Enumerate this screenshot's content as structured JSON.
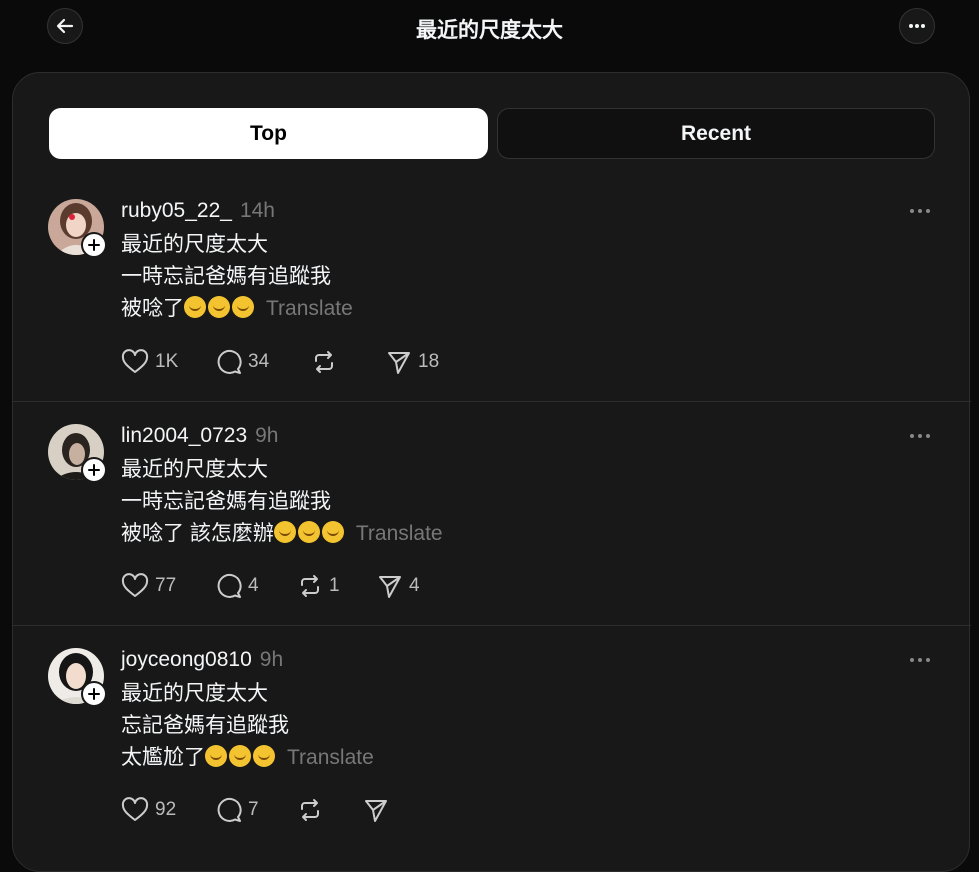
{
  "header": {
    "title": "最近的尺度太大"
  },
  "tabs": [
    {
      "label": "Top",
      "selected": true
    },
    {
      "label": "Recent",
      "selected": false
    }
  ],
  "translate_label": "Translate",
  "posts": [
    {
      "username": "ruby05_22_",
      "time": "14h",
      "lines": [
        "最近的尺度太大",
        "一時忘記爸媽有追蹤我",
        "被唸了"
      ],
      "likes": "1K",
      "replies": "34",
      "reposts": "",
      "shares": "18"
    },
    {
      "username": "lin2004_0723",
      "time": "9h",
      "lines": [
        "最近的尺度太大",
        "一時忘記爸媽有追蹤我",
        "被唸了 該怎麼辦"
      ],
      "likes": "77",
      "replies": "4",
      "reposts": "1",
      "shares": "4"
    },
    {
      "username": "joyceong0810",
      "time": "9h",
      "lines": [
        "最近的尺度太大",
        "忘記爸媽有追蹤我",
        "太尷尬了"
      ],
      "likes": "92",
      "replies": "7",
      "reposts": "",
      "shares": ""
    }
  ],
  "icons": {
    "back": "arrow-left-icon",
    "more": "more-horizontal-icon",
    "like": "heart-icon",
    "reply": "comment-icon",
    "repost": "repost-icon",
    "share": "send-icon",
    "follow": "plus-icon",
    "emoji": "melting-face-emoji"
  },
  "colors": {
    "background": "#0a0a0a",
    "panel": "#181818",
    "muted": "#777777",
    "text": "#f3f5f7"
  }
}
